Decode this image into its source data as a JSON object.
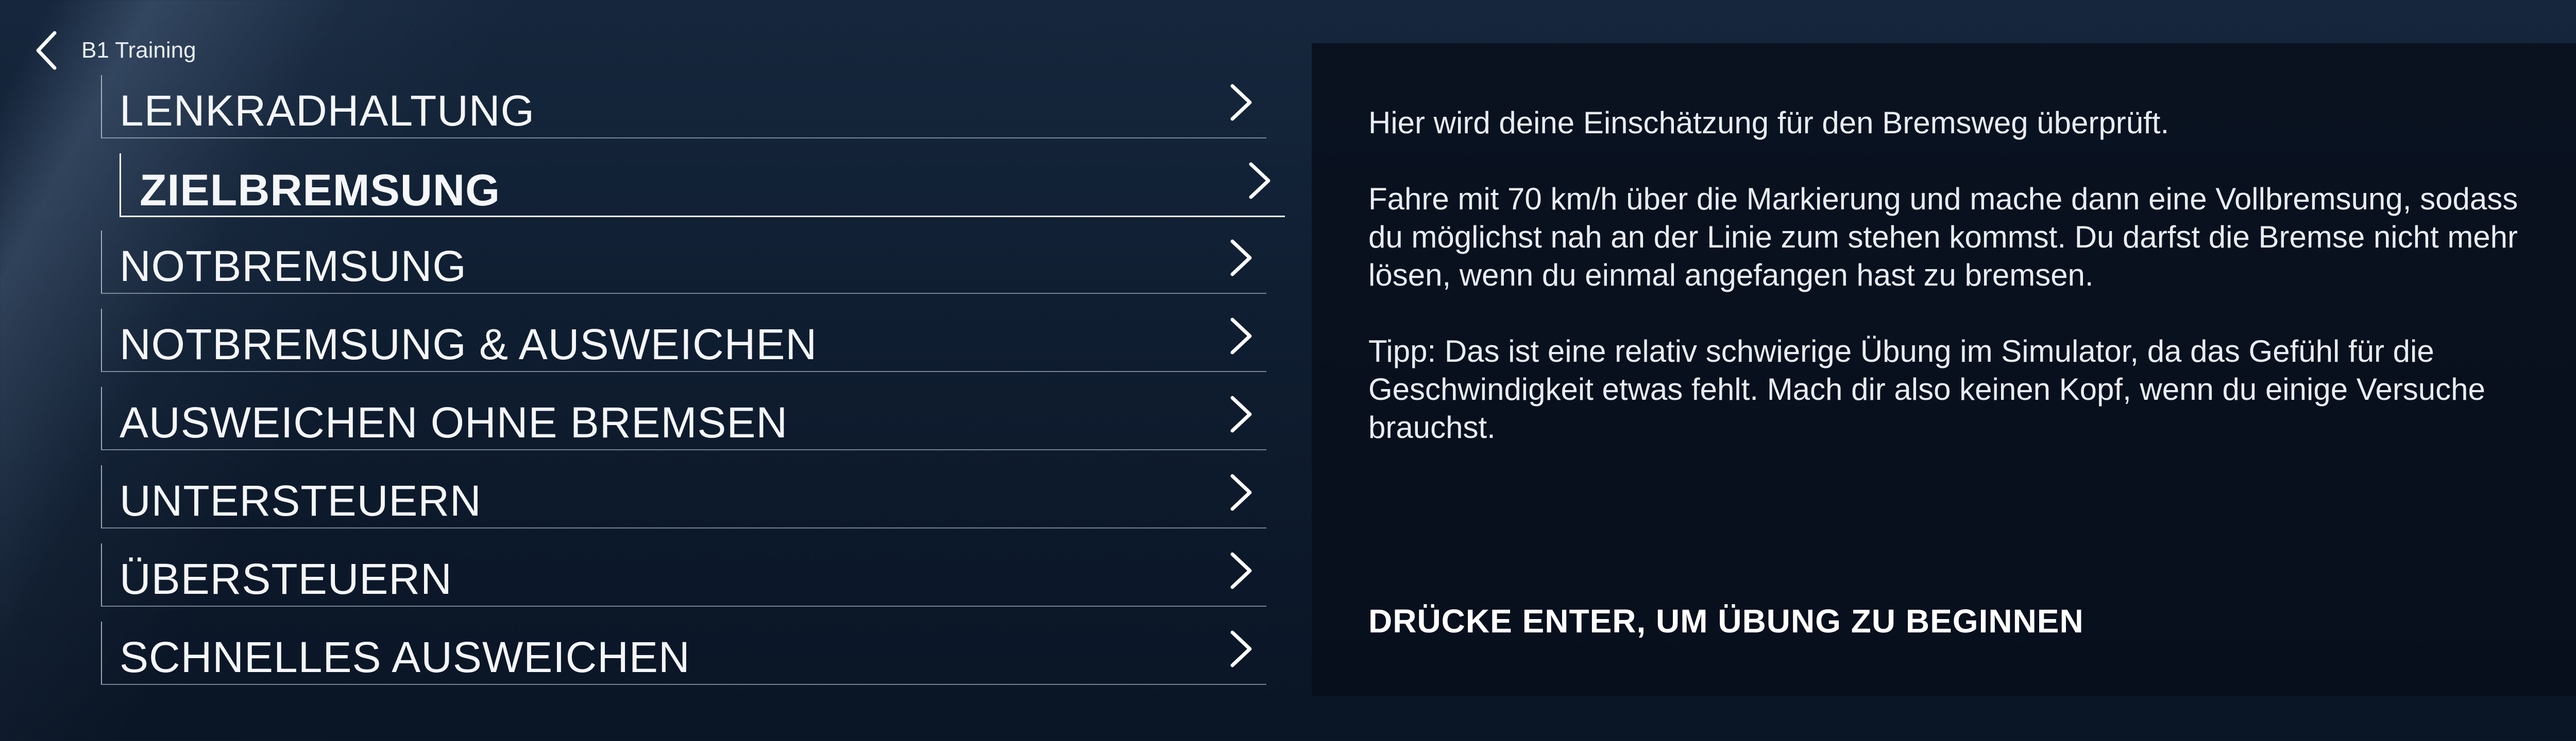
{
  "header": {
    "back_label": "B1 Training",
    "back_icon": "chevron-left-icon"
  },
  "menu": {
    "items": [
      {
        "label": "LENKRADHALTUNG",
        "selected": false
      },
      {
        "label": "ZIELBREMSUNG",
        "selected": true
      },
      {
        "label": "NOTBREMSUNG",
        "selected": false
      },
      {
        "label": "NOTBREMSUNG & AUSWEICHEN",
        "selected": false
      },
      {
        "label": "AUSWEICHEN OHNE BREMSEN",
        "selected": false
      },
      {
        "label": "UNTERSTEUERN",
        "selected": false
      },
      {
        "label": "ÜBERSTEUERN",
        "selected": false
      },
      {
        "label": "SCHNELLES AUSWEICHEN",
        "selected": false
      }
    ],
    "item_icon": "chevron-right-icon"
  },
  "details": {
    "paragraphs": [
      "Hier wird deine Einschätzung für den Bremsweg überprüft.",
      "Fahre mit 70 km/h über die Markierung und mache dann eine Vollbremsung, sodass du möglichst nah an der Linie zum stehen kommst. Du darfst die Bremse nicht mehr lösen, wenn du einmal angefangen hast zu bremsen.",
      "Tipp: Das ist eine relativ schwierige Übung im Simulator, da das Gefühl für die Geschwindigkeit etwas fehlt. Mach dir also keinen Kopf, wenn du einige Versuche brauchst."
    ],
    "start_prompt": "DRÜCKE ENTER, UM ÜBUNG ZU BEGINNEN"
  },
  "colors": {
    "text": "#ffffff",
    "background": "#0f1d30",
    "panel": "#070e1a"
  }
}
